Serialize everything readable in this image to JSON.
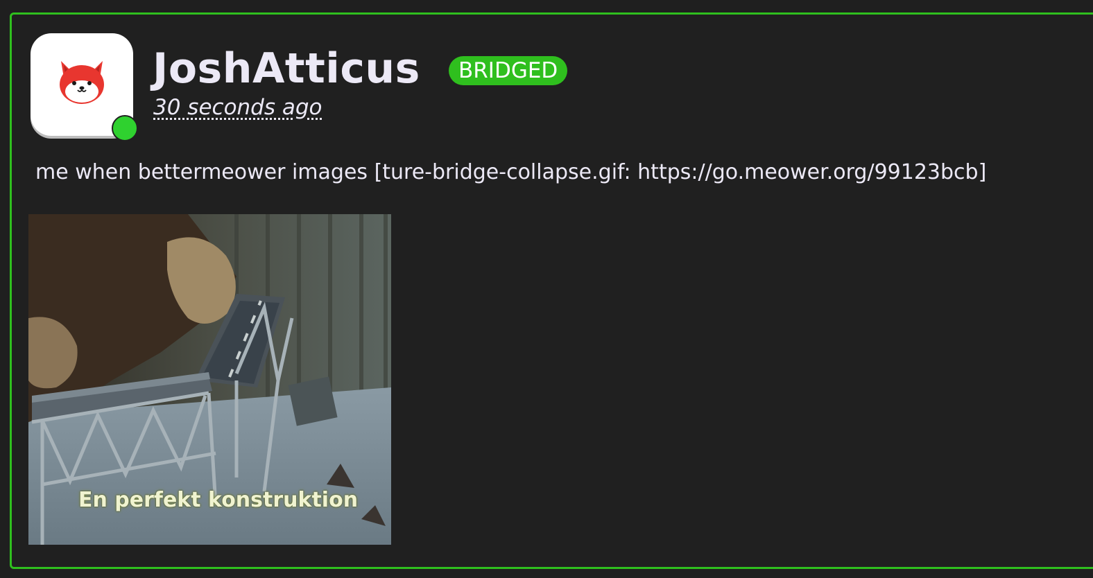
{
  "previous_post": {},
  "post": {
    "author": {
      "username": "JoshAtticus",
      "avatar": "red-fox-cat-avatar",
      "online": true
    },
    "badge": "BRIDGED",
    "timestamp": "30 seconds ago",
    "content": "me when bettermeower images [ture-bridge-collapse.gif: https://go.meower.org/99123bcb]",
    "attachment": {
      "caption": "En perfekt konstruktion"
    }
  },
  "colors": {
    "accent": "#2fbf1e",
    "background": "#202020",
    "text": "#ece9f6",
    "online": "#2fd12f"
  }
}
